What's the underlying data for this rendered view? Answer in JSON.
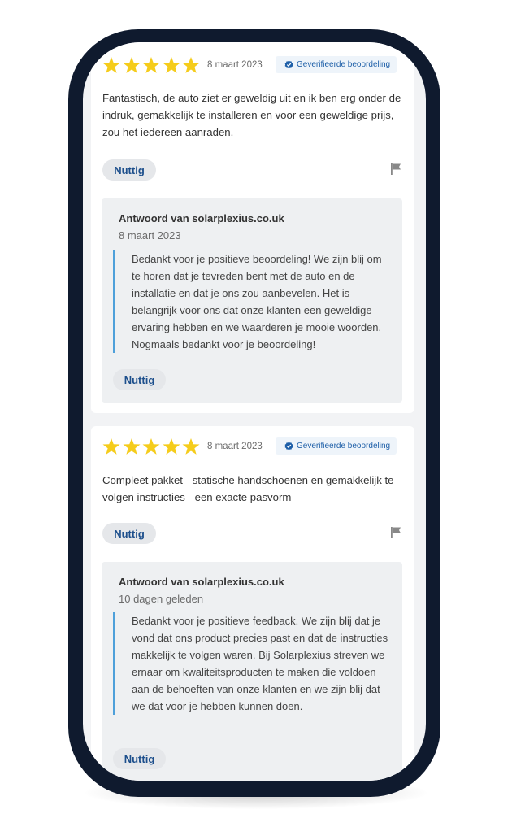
{
  "colors": {
    "star": "#f5cc1b",
    "accent_blue": "#1e5fa8",
    "reply_bar": "#4ea0da",
    "phone_frame": "#0f1a2e"
  },
  "reviews": [
    {
      "rating": 5,
      "date": "8 maart 2023",
      "verified_label": "Geverifieerde beoordeling",
      "text": "Fantastisch, de auto ziet er geweldig uit en ik ben erg onder de indruk, gemakkelijk te installeren en voor een geweldige prijs, zou het iedereen aanraden.",
      "helpful_label": "Nuttig",
      "reply": {
        "author": "Antwoord van solarplexius.co.uk",
        "date": "8 maart 2023",
        "text": "Bedankt voor je positieve beoordeling! We zijn blij om te horen dat je tevreden bent met de auto en de installatie en dat je ons zou aanbevelen. Het is belangrijk voor ons dat onze klanten een geweldige ervaring hebben en we waarderen je mooie woorden. Nogmaals bedankt voor je beoordeling!",
        "helpful_label": "Nuttig"
      }
    },
    {
      "rating": 5,
      "date": "8 maart 2023",
      "verified_label": "Geverifieerde beoordeling",
      "text": "Compleet pakket - statische handschoenen en gemakkelijk te volgen instructies - een exacte pasvorm",
      "helpful_label": "Nuttig",
      "reply": {
        "author": "Antwoord van solarplexius.co.uk",
        "date": "10 dagen geleden",
        "text": "Bedankt voor je positieve feedback. We zijn blij dat je vond dat ons product precies past en dat de instructies makkelijk te volgen waren. Bij Solarplexius streven we ernaar om kwaliteitsproducten te maken die voldoen aan de behoeften van onze klanten en we zijn blij dat we dat voor je hebben kunnen doen.",
        "helpful_label": "Nuttig"
      }
    }
  ]
}
